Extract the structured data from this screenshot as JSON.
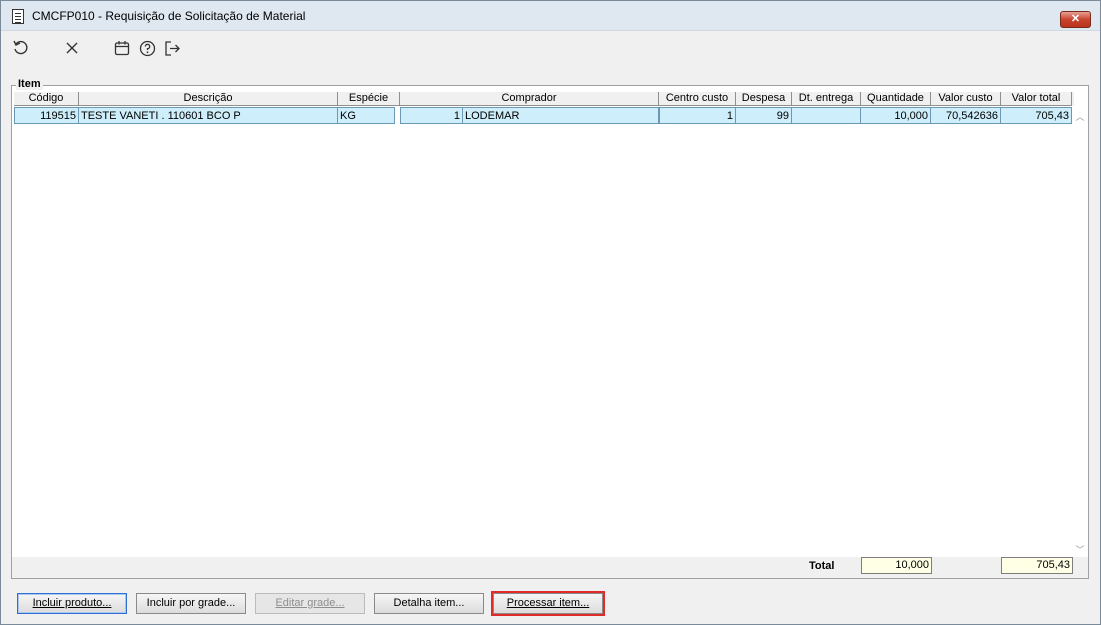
{
  "window": {
    "title": "CMCFP010 - Requisição de Solicitação de Material",
    "close_label": "✕"
  },
  "toolbar": {
    "icons": [
      "refresh-icon",
      "cancel-icon",
      "calendar-icon",
      "help-icon",
      "exit-icon"
    ]
  },
  "group": {
    "label": "Item"
  },
  "grid": {
    "headers": [
      "Código",
      "Descrição",
      "Espécie",
      "Comprador",
      "Centro custo",
      "Despesa",
      "Dt. entrega",
      "Quantidade",
      "Valor custo",
      "Valor total"
    ],
    "rows": [
      {
        "codigo": "119515",
        "descricao": "TESTE VANETI . 110601 BCO P",
        "especie": "KG",
        "comprador_cod": "1",
        "comprador_nome": "LODEMAR",
        "centro_custo": "1",
        "despesa": "99",
        "dt_entrega": "",
        "quantidade": "10,000",
        "valor_custo": "70,542636",
        "valor_total": "705,43"
      }
    ]
  },
  "totals": {
    "label": "Total",
    "quantidade": "10,000",
    "valor_total": "705,43"
  },
  "buttons": {
    "incluir_produto": "Incluir produto...",
    "incluir_grade": "Incluir por grade...",
    "editar_grade": "Editar grade...",
    "detalha_item": "Detalha item...",
    "processar_item": "Processar item..."
  },
  "colors": {
    "row_selected": "#cdeefa",
    "total_box": "#ffffe6",
    "highlight": "#e02b2b"
  }
}
